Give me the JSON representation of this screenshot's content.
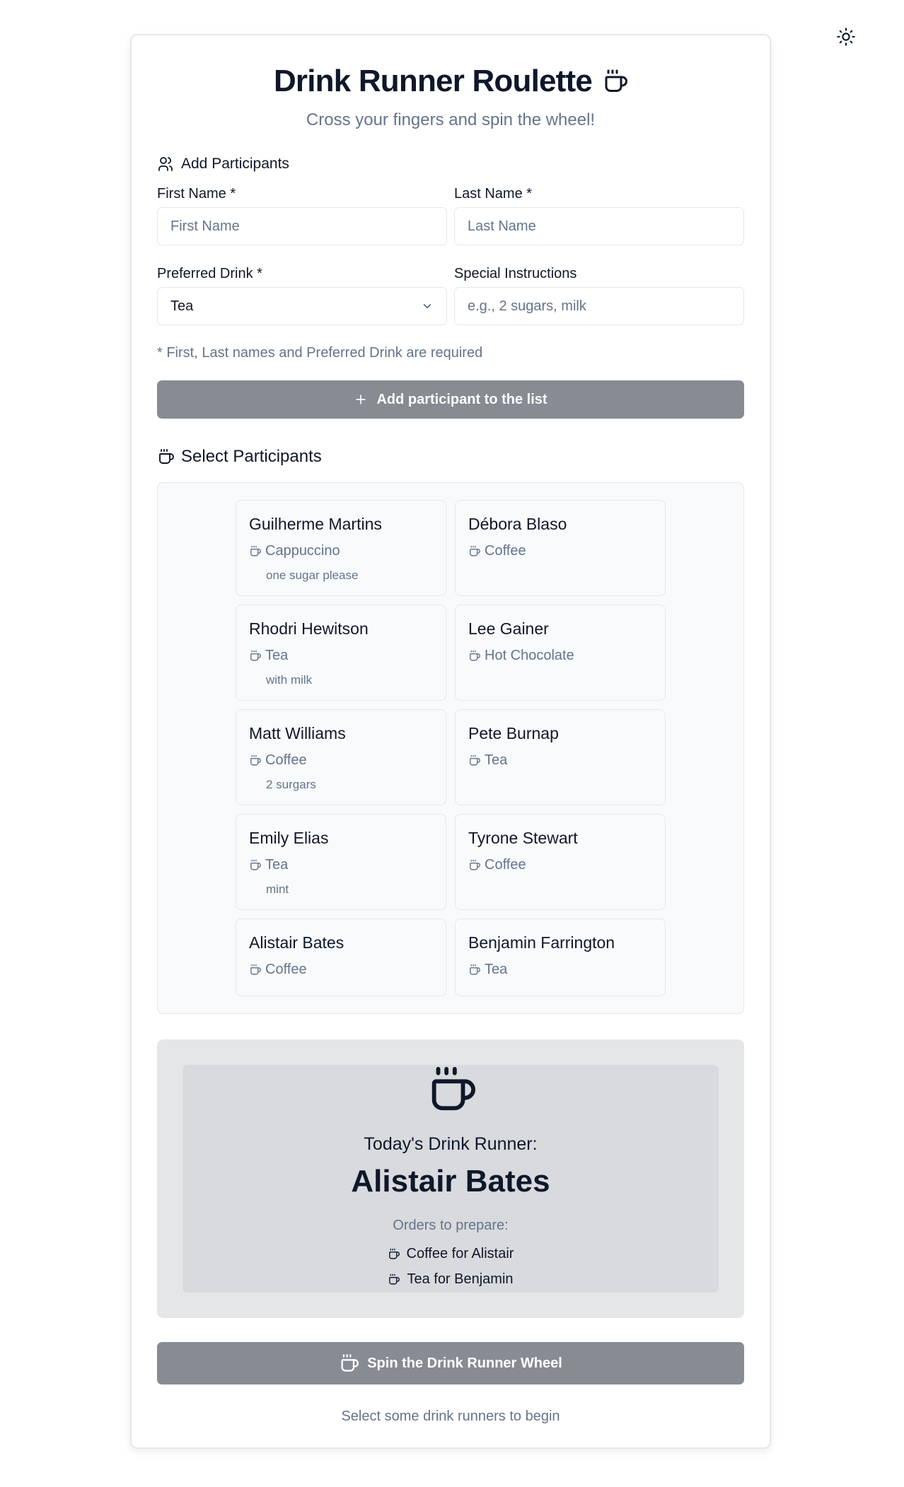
{
  "header": {
    "title": "Drink Runner Roulette",
    "subtitle": "Cross your fingers and spin the wheel!",
    "theme_icon": "sun-icon"
  },
  "add_section": {
    "heading": "Add Participants",
    "first_name_label": "First Name *",
    "first_name_placeholder": "First Name",
    "first_name_value": "",
    "last_name_label": "Last Name *",
    "last_name_placeholder": "Last Name",
    "last_name_value": "",
    "drink_label": "Preferred Drink *",
    "drink_value": "Tea",
    "instructions_label": "Special Instructions",
    "instructions_placeholder": "e.g., 2 sugars, milk",
    "instructions_value": "",
    "required_note": "* First, Last names and Preferred Drink are required",
    "add_button": "Add participant to the list"
  },
  "select_section": {
    "heading": "Select Participants",
    "participants": [
      {
        "name": "Guilherme Martins",
        "drink": "Cappuccino",
        "note": "one sugar please"
      },
      {
        "name": "Débora Blaso",
        "drink": "Coffee",
        "note": ""
      },
      {
        "name": "Rhodri Hewitson",
        "drink": "Tea",
        "note": "with milk"
      },
      {
        "name": "Lee Gainer",
        "drink": "Hot Chocolate",
        "note": ""
      },
      {
        "name": "Matt Williams",
        "drink": "Coffee",
        "note": "2 surgars"
      },
      {
        "name": "Pete Burnap",
        "drink": "Tea",
        "note": ""
      },
      {
        "name": "Emily Elias",
        "drink": "Tea",
        "note": "mint"
      },
      {
        "name": "Tyrone Stewart",
        "drink": "Coffee",
        "note": ""
      },
      {
        "name": "Alistair Bates",
        "drink": "Coffee",
        "note": ""
      },
      {
        "name": "Benjamin Farrington",
        "drink": "Tea",
        "note": ""
      }
    ]
  },
  "result": {
    "label": "Today's Drink Runner:",
    "runner": "Alistair Bates",
    "orders_label": "Orders to prepare:",
    "orders": [
      "Coffee for Alistair",
      "Tea for Benjamin"
    ]
  },
  "spin_button": "Spin the Drink Runner Wheel",
  "hint": "Select some drink runners to begin",
  "colors": {
    "accent_button": "#878b92",
    "text_primary": "#0f172a",
    "text_muted": "#64748b",
    "border": "#e5e7eb"
  }
}
